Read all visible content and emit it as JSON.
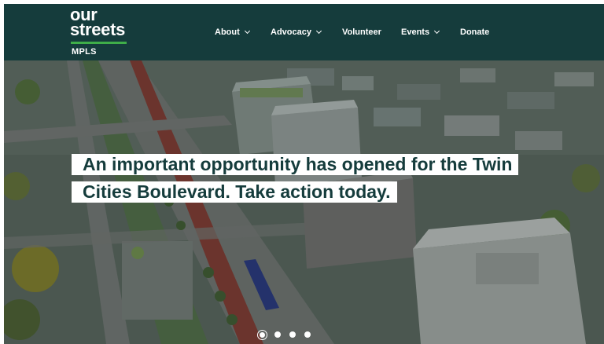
{
  "brand": {
    "logo_line1": "our",
    "logo_line2": "streets",
    "logo_sub": "MPLS",
    "accent": "#3fae49",
    "header_bg": "#153c3c"
  },
  "nav": {
    "items": [
      {
        "label": "About",
        "has_dropdown": true
      },
      {
        "label": "Advocacy",
        "has_dropdown": true
      },
      {
        "label": "Volunteer",
        "has_dropdown": false
      },
      {
        "label": "Events",
        "has_dropdown": true
      },
      {
        "label": "Donate",
        "has_dropdown": false
      }
    ]
  },
  "hero": {
    "headline_line1": "An important opportunity has opened for the Twin",
    "headline_line2": "Cities Boulevard. Take action today.",
    "slide_count": 4,
    "active_slide": 1
  }
}
